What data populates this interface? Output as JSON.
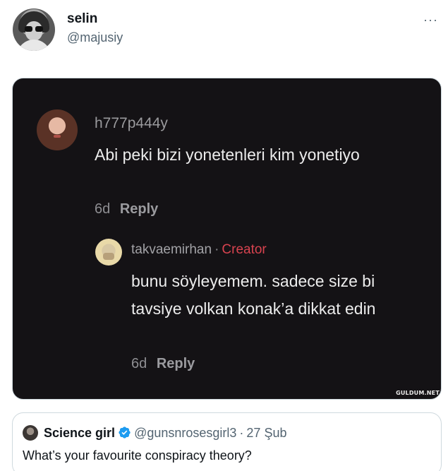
{
  "author": {
    "display_name": "selin",
    "handle": "@majusiy",
    "avatar_icon": "profile-photo-icon"
  },
  "more_icon": "···",
  "media": {
    "comment": {
      "username": "h777p444y",
      "text": "Abi peki bizi yonetenleri kim yonetiyo",
      "age": "6d",
      "reply_label": "Reply"
    },
    "reply": {
      "username": "takvaemirhan",
      "separator": "·",
      "badge": "Creator",
      "text": "bunu söyleyemem. sadece size bi tavsiye volkan konak’a dikkat edin",
      "age": "6d",
      "reply_label": "Reply"
    },
    "watermark": "GULDUM.NET",
    "colors": {
      "background": "#141215",
      "creator_badge": "#d8434f"
    }
  },
  "quote": {
    "display_name": "Science girl",
    "verified_icon": "verified-badge-icon",
    "handle": "@gunsnrosesgirl3",
    "separator": "·",
    "time": "27 Şub",
    "text": "What’s your favourite conspiracy theory?"
  },
  "colors": {
    "verified": "#1d9bf0",
    "secondary_text": "#536471"
  }
}
